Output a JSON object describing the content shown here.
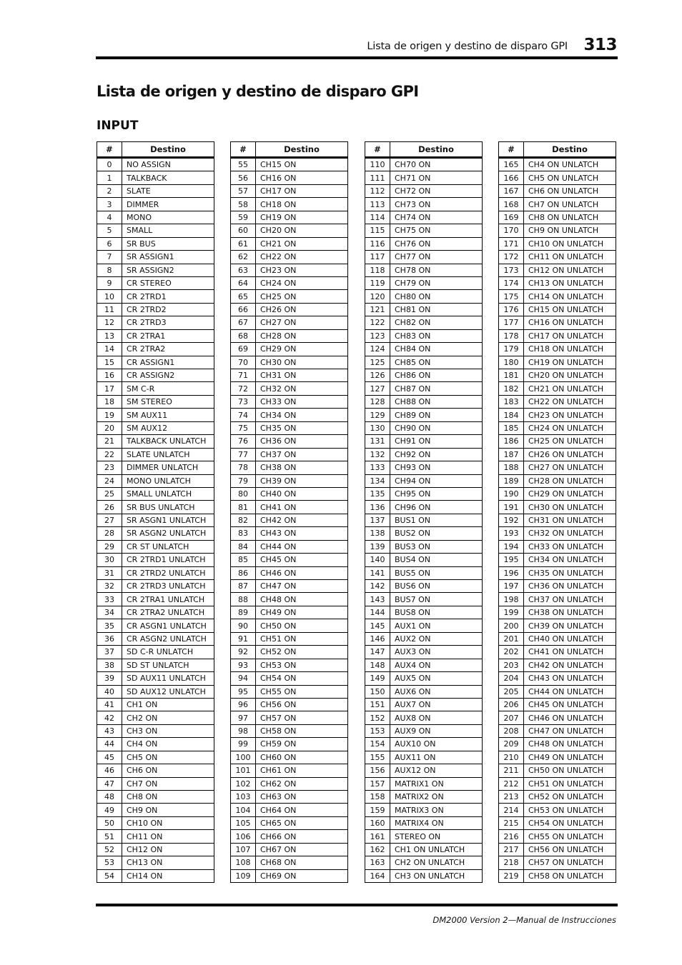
{
  "header": {
    "section_title": "Lista de origen y destino de disparo GPI",
    "page_number": "313"
  },
  "title": "Lista de origen y destino de disparo GPI",
  "subtitle": "INPUT",
  "columns": {
    "num": "#",
    "dest": "Destino"
  },
  "tables": [
    {
      "start": 0,
      "rows": [
        "NO ASSIGN",
        "TALKBACK",
        "SLATE",
        "DIMMER",
        "MONO",
        "SMALL",
        "SR BUS",
        "SR ASSIGN1",
        "SR ASSIGN2",
        "CR STEREO",
        "CR 2TRD1",
        "CR 2TRD2",
        "CR 2TRD3",
        "CR 2TRA1",
        "CR 2TRA2",
        "CR ASSIGN1",
        "CR ASSIGN2",
        "SM C-R",
        "SM STEREO",
        "SM AUX11",
        "SM AUX12",
        "TALKBACK UNLATCH",
        "SLATE UNLATCH",
        "DIMMER UNLATCH",
        "MONO UNLATCH",
        "SMALL UNLATCH",
        "SR BUS UNLATCH",
        "SR ASGN1 UNLATCH",
        "SR ASGN2 UNLATCH",
        "CR ST UNLATCH",
        "CR 2TRD1 UNLATCH",
        "CR 2TRD2 UNLATCH",
        "CR 2TRD3 UNLATCH",
        "CR 2TRA1 UNLATCH",
        "CR 2TRA2 UNLATCH",
        "CR ASGN1 UNLATCH",
        "CR ASGN2 UNLATCH",
        "SD C-R UNLATCH",
        "SD ST UNLATCH",
        "SD AUX11 UNLATCH",
        "SD AUX12 UNLATCH",
        "CH1 ON",
        "CH2 ON",
        "CH3 ON",
        "CH4 ON",
        "CH5 ON",
        "CH6 ON",
        "CH7 ON",
        "CH8 ON",
        "CH9 ON",
        "CH10 ON",
        "CH11 ON",
        "CH12 ON",
        "CH13 ON",
        "CH14 ON"
      ]
    },
    {
      "start": 55,
      "rows": [
        "CH15 ON",
        "CH16 ON",
        "CH17 ON",
        "CH18 ON",
        "CH19 ON",
        "CH20 ON",
        "CH21 ON",
        "CH22 ON",
        "CH23 ON",
        "CH24 ON",
        "CH25 ON",
        "CH26 ON",
        "CH27 ON",
        "CH28 ON",
        "CH29 ON",
        "CH30 ON",
        "CH31 ON",
        "CH32 ON",
        "CH33 ON",
        "CH34 ON",
        "CH35 ON",
        "CH36 ON",
        "CH37 ON",
        "CH38 ON",
        "CH39 ON",
        "CH40 ON",
        "CH41 ON",
        "CH42 ON",
        "CH43 ON",
        "CH44 ON",
        "CH45 ON",
        "CH46 ON",
        "CH47 ON",
        "CH48 ON",
        "CH49 ON",
        "CH50 ON",
        "CH51 ON",
        "CH52 ON",
        "CH53 ON",
        "CH54 ON",
        "CH55 ON",
        "CH56 ON",
        "CH57 ON",
        "CH58 ON",
        "CH59 ON",
        "CH60 ON",
        "CH61 ON",
        "CH62 ON",
        "CH63 ON",
        "CH64 ON",
        "CH65 ON",
        "CH66 ON",
        "CH67 ON",
        "CH68 ON",
        "CH69 ON"
      ]
    },
    {
      "start": 110,
      "rows": [
        "CH70 ON",
        "CH71 ON",
        "CH72 ON",
        "CH73 ON",
        "CH74 ON",
        "CH75 ON",
        "CH76 ON",
        "CH77 ON",
        "CH78 ON",
        "CH79 ON",
        "CH80 ON",
        "CH81 ON",
        "CH82 ON",
        "CH83 ON",
        "CH84 ON",
        "CH85 ON",
        "CH86 ON",
        "CH87 ON",
        "CH88 ON",
        "CH89 ON",
        "CH90 ON",
        "CH91 ON",
        "CH92 ON",
        "CH93 ON",
        "CH94 ON",
        "CH95 ON",
        "CH96 ON",
        "BUS1 ON",
        "BUS2 ON",
        "BUS3 ON",
        "BUS4 ON",
        "BUS5 ON",
        "BUS6 ON",
        "BUS7 ON",
        "BUS8 ON",
        "AUX1 ON",
        "AUX2 ON",
        "AUX3 ON",
        "AUX4 ON",
        "AUX5 ON",
        "AUX6 ON",
        "AUX7 ON",
        "AUX8 ON",
        "AUX9 ON",
        "AUX10 ON",
        "AUX11 ON",
        "AUX12 ON",
        "MATRIX1 ON",
        "MATRIX2 ON",
        "MATRIX3 ON",
        "MATRIX4 ON",
        "STEREO ON",
        "CH1 ON UNLATCH",
        "CH2 ON UNLATCH",
        "CH3 ON UNLATCH"
      ]
    },
    {
      "start": 165,
      "rows": [
        "CH4 ON UNLATCH",
        "CH5 ON UNLATCH",
        "CH6 ON UNLATCH",
        "CH7 ON UNLATCH",
        "CH8 ON UNLATCH",
        "CH9 ON UNLATCH",
        "CH10 ON UNLATCH",
        "CH11 ON UNLATCH",
        "CH12 ON UNLATCH",
        "CH13 ON UNLATCH",
        "CH14 ON UNLATCH",
        "CH15 ON UNLATCH",
        "CH16 ON UNLATCH",
        "CH17 ON UNLATCH",
        "CH18 ON UNLATCH",
        "CH19 ON UNLATCH",
        "CH20 ON UNLATCH",
        "CH21 ON UNLATCH",
        "CH22 ON UNLATCH",
        "CH23 ON UNLATCH",
        "CH24 ON UNLATCH",
        "CH25 ON UNLATCH",
        "CH26 ON UNLATCH",
        "CH27 ON UNLATCH",
        "CH28 ON UNLATCH",
        "CH29 ON UNLATCH",
        "CH30 ON UNLATCH",
        "CH31 ON UNLATCH",
        "CH32 ON UNLATCH",
        "CH33 ON UNLATCH",
        "CH34 ON UNLATCH",
        "CH35 ON UNLATCH",
        "CH36 ON UNLATCH",
        "CH37 ON UNLATCH",
        "CH38 ON UNLATCH",
        "CH39 ON UNLATCH",
        "CH40 ON UNLATCH",
        "CH41 ON UNLATCH",
        "CH42 ON UNLATCH",
        "CH43 ON UNLATCH",
        "CH44 ON UNLATCH",
        "CH45 ON UNLATCH",
        "CH46 ON UNLATCH",
        "CH47 ON UNLATCH",
        "CH48 ON UNLATCH",
        "CH49 ON UNLATCH",
        "CH50 ON UNLATCH",
        "CH51 ON UNLATCH",
        "CH52 ON UNLATCH",
        "CH53 ON UNLATCH",
        "CH54 ON UNLATCH",
        "CH55 ON UNLATCH",
        "CH56 ON UNLATCH",
        "CH57 ON UNLATCH",
        "CH58 ON UNLATCH"
      ]
    }
  ],
  "footer": "DM2000 Version 2—Manual de Instrucciones"
}
